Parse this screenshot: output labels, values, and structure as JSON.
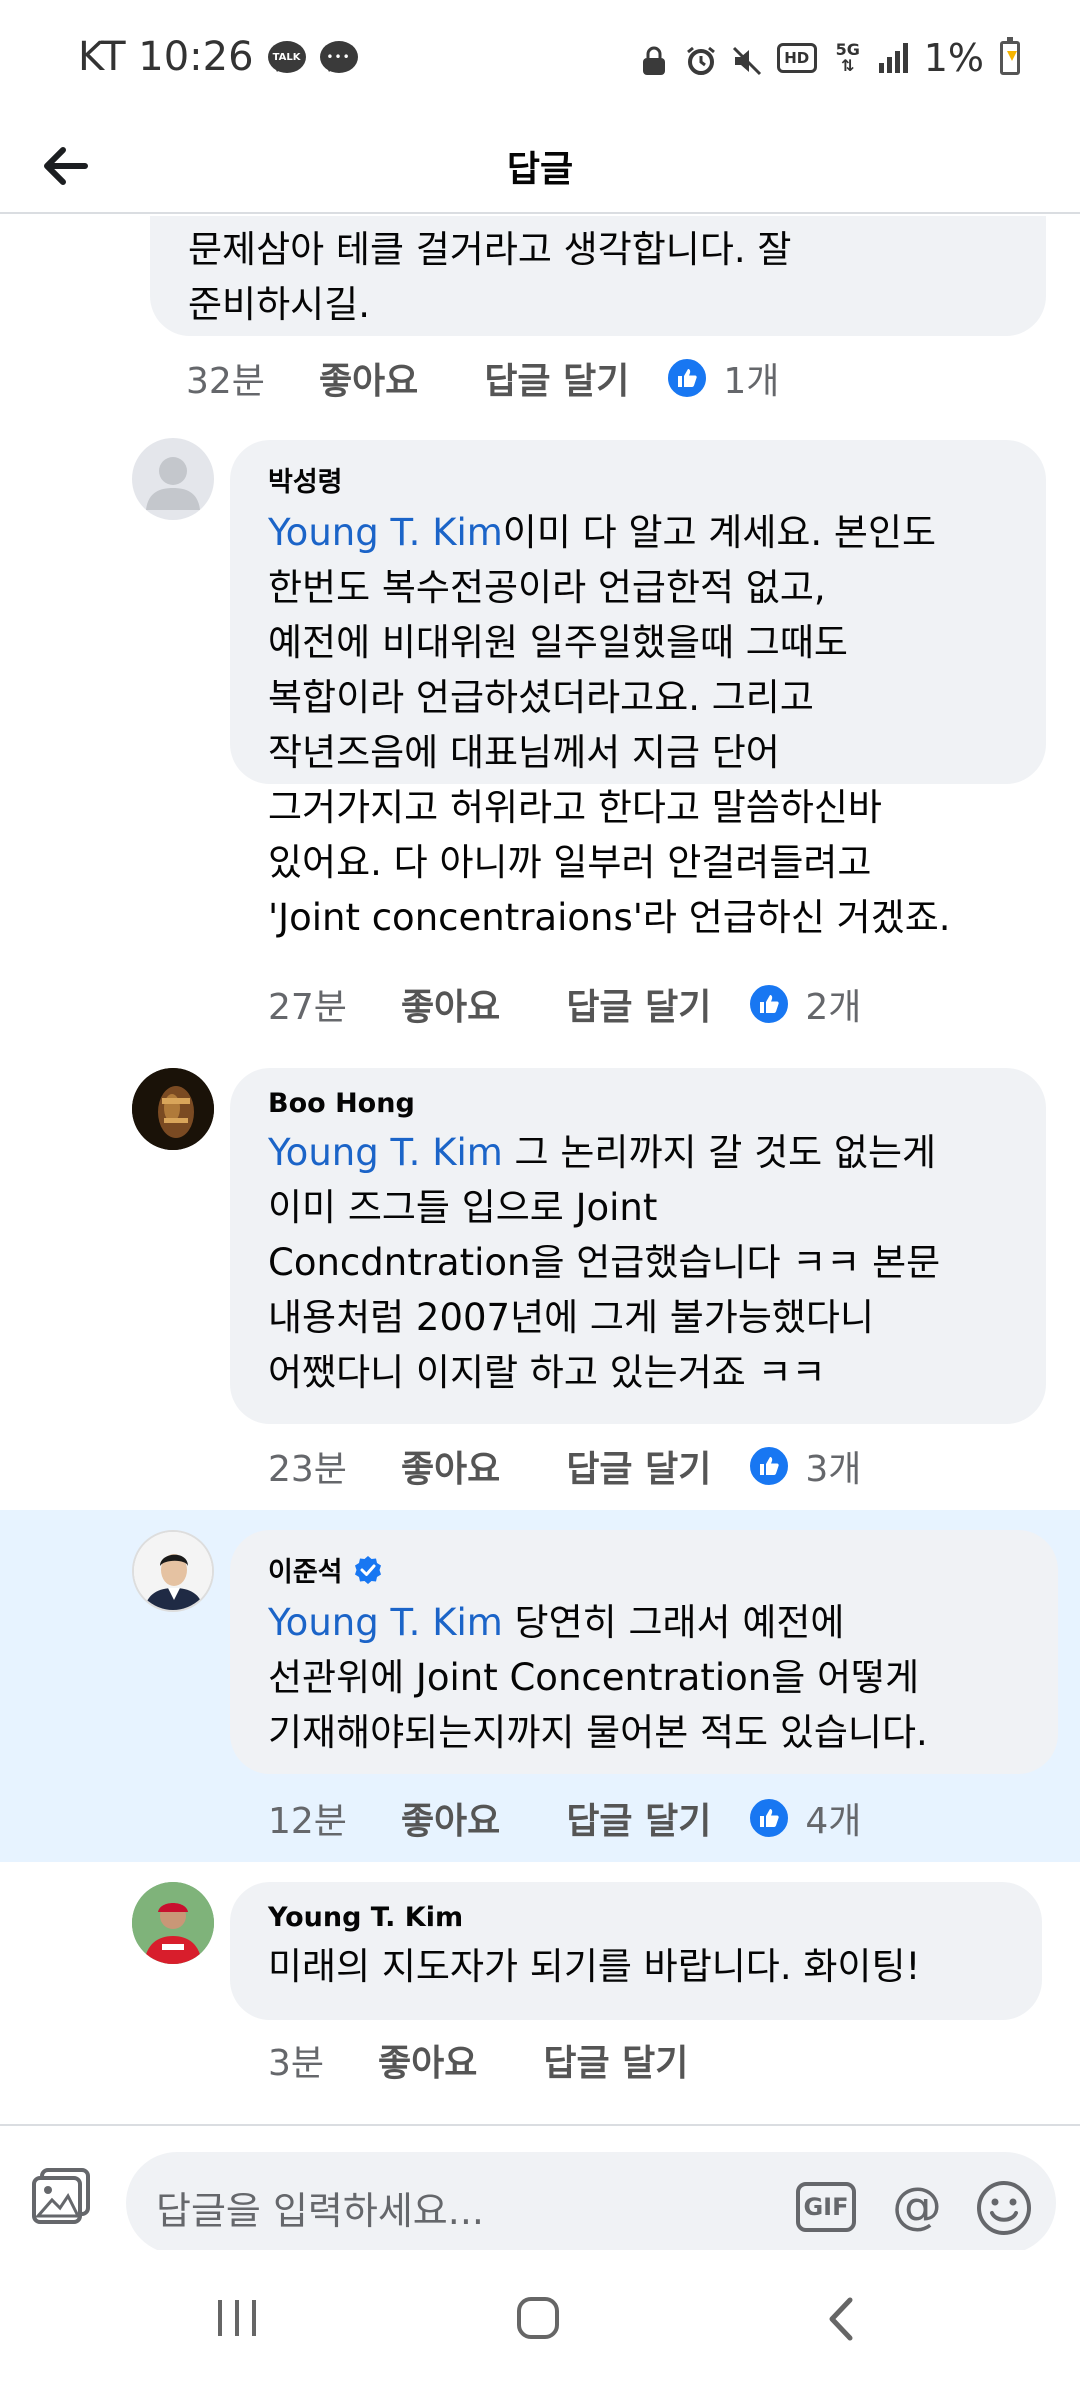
{
  "status_bar": {
    "carrier_time": "KT 10:26",
    "talk_label": "TALK",
    "battery": "1%"
  },
  "header": {
    "title": "답글"
  },
  "comments": [
    {
      "partial": true,
      "text_line1": "문제삼아 테클 걸거라고 생각합니다. 잘",
      "text_line2": "준비하시길.",
      "time": "32분",
      "like": "좋아요",
      "reply": "답글 달기",
      "likes": "1개"
    },
    {
      "author": "박성령",
      "mention": "Young T. Kim",
      "lines": [
        "이미 다 알고 계세요. 본인도",
        "한번도 복수전공이라 언급한적 없고,",
        "예전에 비대위원 일주일했을때 그때도",
        "복합이라 언급하셨더라고요. 그리고",
        "작년즈음에 대표님께서 지금 단어",
        "그거가지고 허위라고 한다고 말씀하신바",
        "있어요. 다 아니까 일부러 안걸려들려고",
        "'Joint concentraions'라 언급하신 거겠죠."
      ],
      "time": "27분",
      "like": "좋아요",
      "reply": "답글 달기",
      "likes": "2개"
    },
    {
      "author": "Boo Hong",
      "mention": "Young T. Kim",
      "lines": [
        " 그 논리까지 갈 것도 없는게",
        "이미 즈그들 입으로 Joint",
        "Concdntration을 언급했습니다 ㅋㅋ 본문",
        "내용처럼 2007년에 그게 불가능했다니",
        "어쨌다니 이지랄 하고 있는거죠 ㅋㅋ"
      ],
      "time": "23분",
      "like": "좋아요",
      "reply": "답글 달기",
      "likes": "3개"
    },
    {
      "author": "이준석",
      "verified": true,
      "mention": "Young T. Kim",
      "lines": [
        " 당연히 그래서 예전에",
        "선관위에 Joint Concentration을 어떻게",
        "기재해야되는지까지 물어본 적도 있습니다."
      ],
      "time": "12분",
      "like": "좋아요",
      "reply": "답글 달기",
      "likes": "4개"
    },
    {
      "author": "Young T. Kim",
      "lines": [
        "미래의 지도자가 되기를 바랍니다. 화이팅!"
      ],
      "time": "3분",
      "like": "좋아요",
      "reply": "답글 달기"
    }
  ],
  "composer": {
    "placeholder": "답글을 입력하세요...",
    "gif_label": "GIF",
    "at_label": "@"
  },
  "colors": {
    "mention": "#1b64c8",
    "like_blue": "#1877f2",
    "highlight_bg": "#e7f3ff",
    "bubble_bg": "#f0f2f5"
  },
  "icons": [
    "back-arrow-icon",
    "thumbs-up-icon",
    "verified-badge-icon",
    "photo-icon",
    "gif-icon",
    "at-icon",
    "emoji-icon",
    "recents-icon",
    "home-icon",
    "nav-back-icon"
  ]
}
